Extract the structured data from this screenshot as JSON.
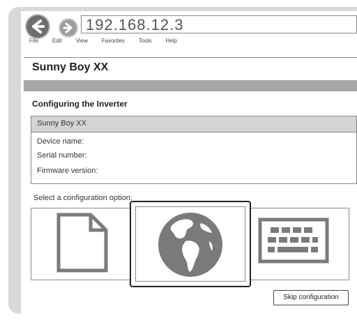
{
  "browser": {
    "url": "192.168.12.3",
    "menu": [
      "File",
      "Edit",
      "View",
      "Favorites",
      "Tools",
      "Help"
    ]
  },
  "page": {
    "title": "Sunny Boy XX",
    "section_title": "Configuring the Inverter",
    "card": {
      "header": "Sunny Boy XX",
      "device_name_label": "Device name:",
      "serial_number_label": "Serial number:",
      "firmware_version_label": "Firmware version:"
    },
    "select_label": "Select a configuration option:",
    "skip_label": "Skip configuration"
  },
  "icons": {
    "back": "arrow-left-icon",
    "forward": "arrow-right-icon",
    "document": "document-icon",
    "globe": "globe-icon",
    "keyboard": "keyboard-icon"
  },
  "colors": {
    "frame": "#d9d9d9",
    "graybar": "#a6a6a6",
    "icon_gray": "#7a7a7a"
  }
}
